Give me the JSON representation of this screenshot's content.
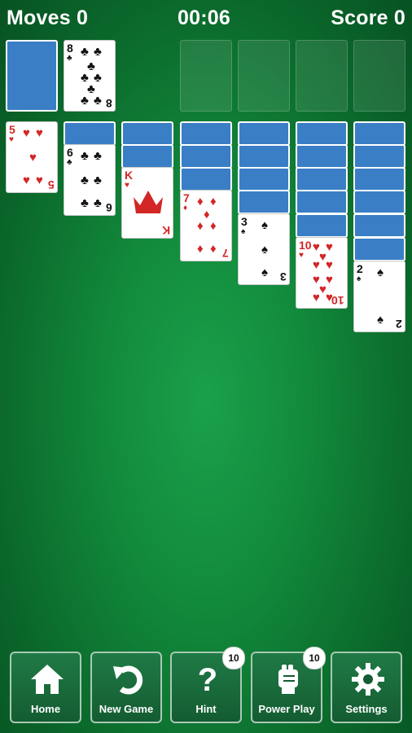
{
  "hud": {
    "moves": "Moves 0",
    "timer": "00:06",
    "score": "Score 0"
  },
  "colors": {
    "table": "#128a3c",
    "card_back": "#3a7ec6",
    "red_suit": "#d32626"
  },
  "stock": {
    "state": "face-down"
  },
  "waste": {
    "rank": "8",
    "suit": "♣"
  },
  "tableau": [
    {
      "hidden": 0,
      "rank": "5",
      "suit": "♥"
    },
    {
      "hidden": 1,
      "rank": "6",
      "suit": "♣"
    },
    {
      "hidden": 2,
      "rank": "K",
      "suit": "♥"
    },
    {
      "hidden": 3,
      "rank": "7",
      "suit": "♦"
    },
    {
      "hidden": 4,
      "rank": "3",
      "suit": "♠"
    },
    {
      "hidden": 5,
      "rank": "10",
      "suit": "♥"
    },
    {
      "hidden": 6,
      "rank": "2",
      "suit": "♠"
    }
  ],
  "toolbar": {
    "home": "Home",
    "new_game": "New Game",
    "hint": "Hint",
    "hint_badge": "10",
    "power_play": "Power Play",
    "power_badge": "10",
    "settings": "Settings"
  }
}
